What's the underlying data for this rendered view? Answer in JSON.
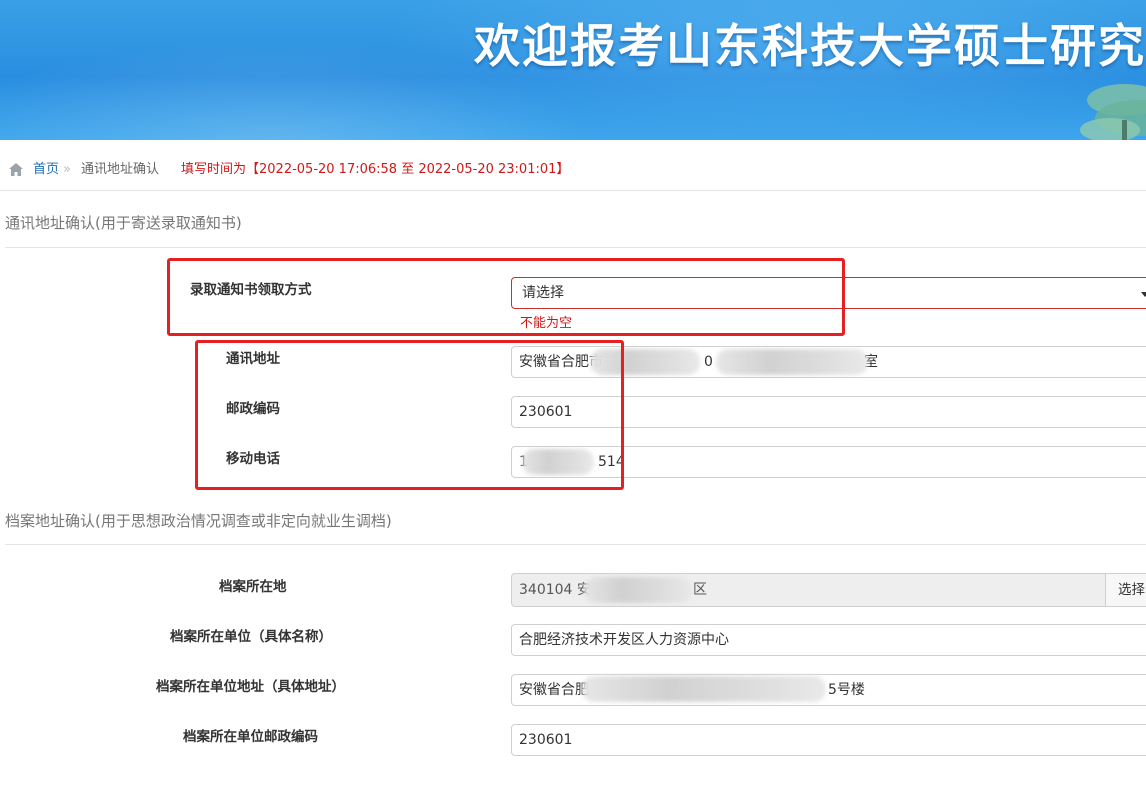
{
  "banner": {
    "title": "欢迎报考山东科技大学硕士研究"
  },
  "breadcrumb": {
    "home": "首页",
    "separator": "»",
    "current": "通讯地址确认",
    "fill_time": "填写时间为【2022-05-20 17:06:58 至 2022-05-20 23:01:01】"
  },
  "section1": {
    "title": "通讯地址确认(用于寄送录取通知书)",
    "pickup_label": "录取通知书领取方式",
    "pickup_value": "请选择",
    "pickup_error": "不能为空",
    "address_label": "通讯地址",
    "address_value_start": "安徽省合肥市",
    "address_value_mid": "0",
    "address_value_end": "室",
    "postcode_label": "邮政编码",
    "postcode_value": "230601",
    "phone_label": "移动电话",
    "phone_value_start": "1",
    "phone_value_end": "514"
  },
  "section2": {
    "title": "档案地址确认(用于思想政治情况调查或非定向就业生调档)",
    "location_label": "档案所在地",
    "location_value_start": "340104 安",
    "location_value_end": "区",
    "location_button": "选择",
    "unit_label": "档案所在单位（具体名称）",
    "unit_value": "合肥经济技术开发区人力资源中心",
    "unit_address_label": "档案所在单位地址（具体地址）",
    "unit_address_start": "安徽省合肥",
    "unit_address_end": "5号楼",
    "unit_postcode_label": "档案所在单位邮政编码",
    "unit_postcode_value": "230601"
  },
  "colors": {
    "banner": "#2a8ee0",
    "link": "#1a6fb5",
    "error": "#d01818",
    "highlight": "#e62020"
  }
}
